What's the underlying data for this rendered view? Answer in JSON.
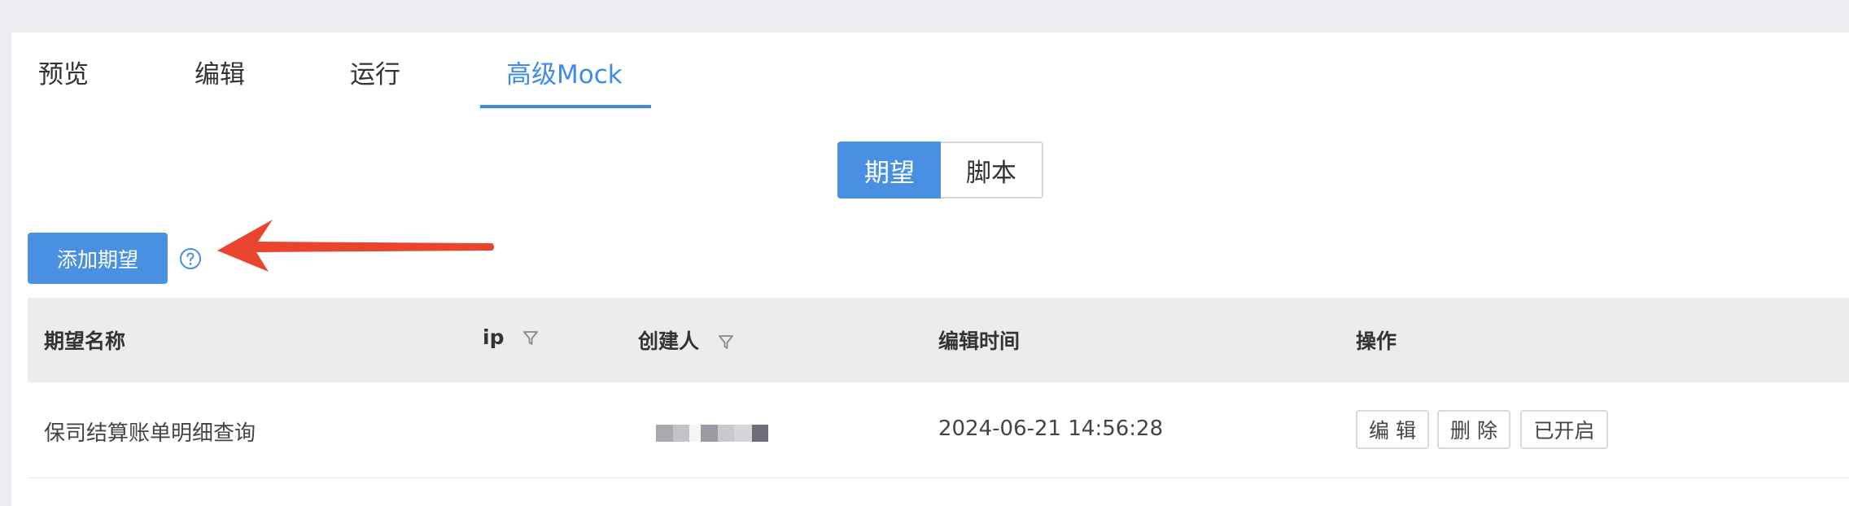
{
  "tabs": [
    "预览",
    "编辑",
    "运行",
    "高级Mock"
  ],
  "segments": {
    "expect": "期望",
    "script": "脚本"
  },
  "toolbar": {
    "add_label": "添加期望"
  },
  "table": {
    "headers": {
      "name": "期望名称",
      "ip": "ip",
      "creator": "创建人",
      "edit_time": "编辑时间",
      "actions": "操作"
    },
    "rows": [
      {
        "name": "保司结算账单明细查询",
        "ip": "",
        "edit_time": "2024-06-21 14:56:28",
        "actions": [
          "编 辑",
          "删 除",
          "已开启"
        ]
      }
    ]
  },
  "colors": {
    "accent": "#4a90e2",
    "tab_active": "#3d8ce8",
    "arrow": "#e8442e"
  },
  "icons": [
    "question-circle-icon",
    "filter-icon",
    "arrow-annotation"
  ]
}
